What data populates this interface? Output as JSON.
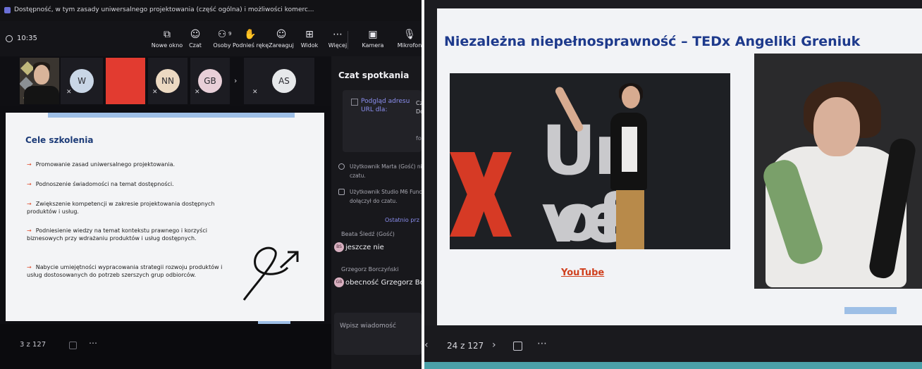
{
  "left": {
    "window_title": "Dostępność, w tym zasady uniwersalnego projektowania (część ogólna) i możliwości komerc...",
    "clock": "10:35",
    "toolbar": [
      {
        "label": "Nowe okno",
        "icon": "new-window-icon",
        "glyph": "⧉"
      },
      {
        "label": "Czat",
        "icon": "chat-icon",
        "glyph": "☺",
        "active": true
      },
      {
        "label": "Osoby",
        "icon": "people-icon",
        "glyph": "⚇",
        "badge": "9"
      },
      {
        "label": "Podnieś rękę",
        "icon": "raise-hand-icon",
        "glyph": "✋"
      },
      {
        "label": "Zareaguj",
        "icon": "react-icon",
        "glyph": "☺"
      },
      {
        "label": "Widok",
        "icon": "view-icon",
        "glyph": "⊞"
      },
      {
        "label": "Więcej",
        "icon": "more-icon",
        "glyph": "⋯"
      },
      {
        "label": "Kamera",
        "icon": "camera-off-icon",
        "glyph": "▣"
      },
      {
        "label": "Mikrofon",
        "icon": "mic-off-icon",
        "glyph": "🎙"
      }
    ],
    "participants": [
      {
        "initials": "W",
        "color": "#c9d6e6"
      },
      {
        "initials": "NN",
        "color": "#ecd9c2"
      },
      {
        "initials": "GB",
        "color": "#e8cfd8"
      },
      {
        "initials": "AS",
        "color": "#e6e8ea"
      }
    ],
    "chat": {
      "title": "Czat spotkania",
      "preview_alt": "Podgląd adresu URL dla:",
      "card_side1": "Cz",
      "card_side2": "Do",
      "card_side3": "fo",
      "system_messages": [
        "Użytkownik Marta (Gość) ni czatu.",
        "Użytkownik Studio M6 Func dołączył do czatu."
      ],
      "recent_label": "Ostatnio prz",
      "messages": [
        {
          "sender": "Beata Śledź (Gość)",
          "initials": "BS",
          "text": "jeszcze nie"
        },
        {
          "sender": "Grzegorz Borczyński",
          "initials": "GB",
          "text": "obecność Grzegorz Borc"
        }
      ],
      "compose_placeholder": "Wpisz wiadomość"
    },
    "slide": {
      "title": "Cele szkolenia",
      "bullets": [
        "Promowanie zasad uniwersalnego projektowania.",
        "Podnoszenie świadomości na temat dostępności.",
        "Zwiększenie kompetencji w zakresie projektowania dostępnych produktów i usług.",
        "Podniesienie wiedzy na temat kontekstu prawnego i korzyści biznesowych przy wdrażaniu produktów i usług dostępnych.",
        "Nabycie umiejętności wypracowania strategii rozwoju produktów i usług dostosowanych do potrzeb szerszych grup odbiorców."
      ],
      "arrow": "→"
    },
    "pager": "3 z 127",
    "more": "⋯"
  },
  "right": {
    "slide": {
      "title": "Niezależna niepełnosprawność – TEDx Angeliki Greniuk",
      "link": "YouTube",
      "photo_text_top": "Un ve",
      "photo_text_bottom": "of Wa"
    },
    "pager": "24 z 127",
    "prev": "‹",
    "next": "›",
    "more": "⋯"
  }
}
